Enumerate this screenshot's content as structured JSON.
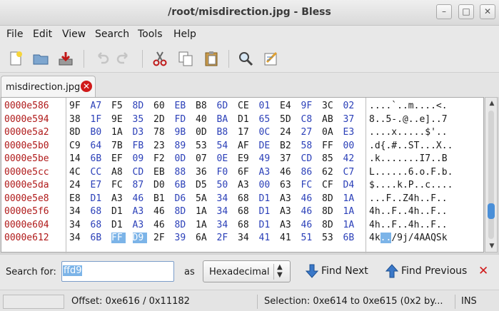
{
  "window": {
    "title": "/root/misdirection.jpg - Bless"
  },
  "menu": [
    "File",
    "Edit",
    "View",
    "Search",
    "Tools",
    "Help"
  ],
  "toolbar": [
    "new-file",
    "open-file",
    "save-file",
    "undo",
    "redo",
    "cut",
    "copy",
    "paste",
    "find",
    "preferences"
  ],
  "tab": {
    "label": "misdirection.jpg"
  },
  "hex": {
    "rows": [
      {
        "offset": "0000e586",
        "bytes": [
          "9F",
          "A7",
          "F5",
          "8D",
          "60",
          "EB",
          "B8",
          "6D",
          "CE",
          "01",
          "E4",
          "9F",
          "3C",
          "02"
        ],
        "ascii": "....`..m....<."
      },
      {
        "offset": "0000e594",
        "bytes": [
          "38",
          "1F",
          "9E",
          "35",
          "2D",
          "FD",
          "40",
          "BA",
          "D1",
          "65",
          "5D",
          "C8",
          "AB",
          "37"
        ],
        "ascii": "8..5-.@..e]..7"
      },
      {
        "offset": "0000e5a2",
        "bytes": [
          "8D",
          "B0",
          "1A",
          "D3",
          "78",
          "9B",
          "0D",
          "B8",
          "17",
          "0C",
          "24",
          "27",
          "0A",
          "E3"
        ],
        "ascii": "....x.....$'.."
      },
      {
        "offset": "0000e5b0",
        "bytes": [
          "C9",
          "64",
          "7B",
          "FB",
          "23",
          "89",
          "53",
          "54",
          "AF",
          "DE",
          "B2",
          "58",
          "FF",
          "00"
        ],
        "ascii": ".d{.#..ST...X.."
      },
      {
        "offset": "0000e5be",
        "bytes": [
          "14",
          "6B",
          "EF",
          "09",
          "F2",
          "0D",
          "07",
          "0E",
          "E9",
          "49",
          "37",
          "CD",
          "85",
          "42"
        ],
        "ascii": ".k.......I7..B"
      },
      {
        "offset": "0000e5cc",
        "bytes": [
          "4C",
          "CC",
          "A8",
          "CD",
          "EB",
          "88",
          "36",
          "F0",
          "6F",
          "A3",
          "46",
          "86",
          "62",
          "C7"
        ],
        "ascii": "L......6.o.F.b."
      },
      {
        "offset": "0000e5da",
        "bytes": [
          "24",
          "E7",
          "FC",
          "87",
          "D0",
          "6B",
          "D5",
          "50",
          "A3",
          "00",
          "63",
          "FC",
          "CF",
          "D4"
        ],
        "ascii": "$....k.P..c...."
      },
      {
        "offset": "0000e5e8",
        "bytes": [
          "E8",
          "D1",
          "A3",
          "46",
          "B1",
          "D6",
          "5A",
          "34",
          "68",
          "D1",
          "A3",
          "46",
          "8D",
          "1A"
        ],
        "ascii": "...F..Z4h..F.."
      },
      {
        "offset": "0000e5f6",
        "bytes": [
          "34",
          "68",
          "D1",
          "A3",
          "46",
          "8D",
          "1A",
          "34",
          "68",
          "D1",
          "A3",
          "46",
          "8D",
          "1A"
        ],
        "ascii": "4h..F..4h..F.."
      },
      {
        "offset": "0000e604",
        "bytes": [
          "34",
          "68",
          "D1",
          "A3",
          "46",
          "8D",
          "1A",
          "34",
          "68",
          "D1",
          "A3",
          "46",
          "8D",
          "1A"
        ],
        "ascii": "4h..F..4h..F.."
      },
      {
        "offset": "0000e612",
        "bytes": [
          "34",
          "6B",
          "FF",
          "D9",
          "2F",
          "39",
          "6A",
          "2F",
          "34",
          "41",
          "41",
          "51",
          "53",
          "6B"
        ],
        "ascii_before": "4k",
        "ascii_sel": "..",
        "ascii_after": "/9j/4AAQSk"
      }
    ],
    "selected": {
      "row": 10,
      "cols": [
        2,
        3
      ]
    },
    "blue_columns": [
      1,
      3,
      5,
      7,
      9,
      11,
      13
    ]
  },
  "find": {
    "label": "Search for:",
    "value": "ffd9",
    "as_label": "as",
    "mode": "Hexadecimal",
    "find_next": "Find Next",
    "find_previous": "Find Previous"
  },
  "status": {
    "offset": "Offset: 0xe616 / 0x11182",
    "selection": "Selection: 0xe614 to 0xe615 (0x2 by...",
    "mode": "INS"
  },
  "colors": {
    "offset": "#b01a1a",
    "hex_blue": "#2a3fb8",
    "selection": "#7cb4e8",
    "close_red": "#d01a1a"
  }
}
